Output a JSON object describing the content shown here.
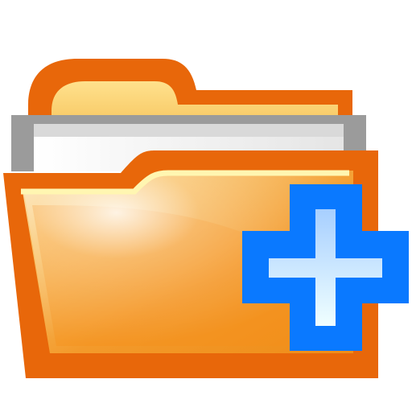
{
  "icon": {
    "name": "new-folder-icon",
    "parts": [
      "folder-icon",
      "add-icon"
    ]
  },
  "colors": {
    "background": "#ffffff",
    "folder_outline": "#e8670a",
    "folder_tab": "#f7c95c",
    "folder_front_light": "#fde7b8",
    "folder_front_mid": "#f7a63a",
    "folder_front_dark": "#ee8416",
    "paper_outline": "#9b9b9b",
    "paper_fill": "#f4f4f4",
    "plus_outline": "#0a79ff",
    "plus_fill_top": "#b8d8ff",
    "plus_fill_bottom": "#e9fbff"
  }
}
